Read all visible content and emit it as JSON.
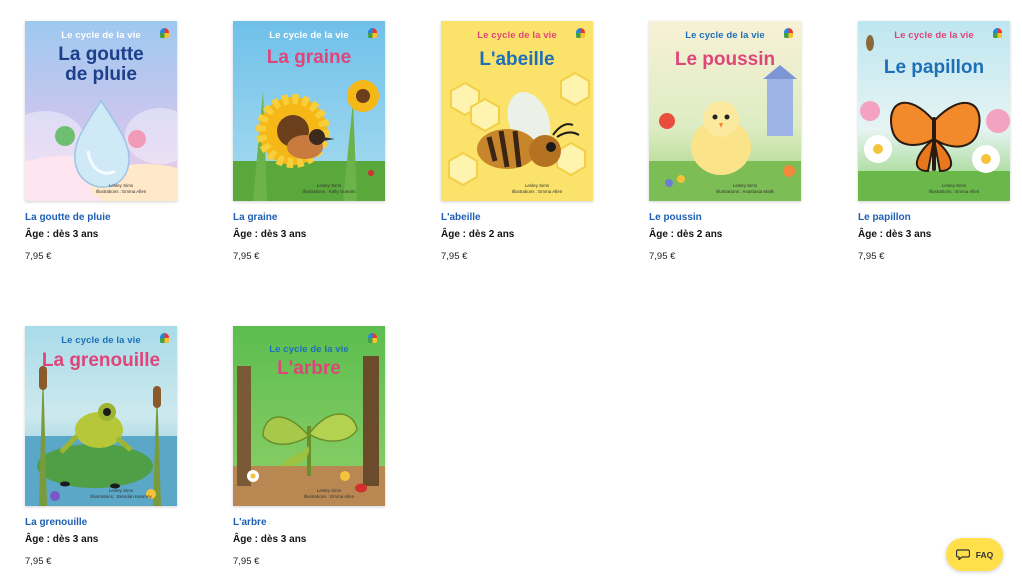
{
  "series_label": "Le cycle de la vie",
  "books": [
    {
      "title": "La goutte de pluie",
      "cover_title_lines": [
        "La goutte",
        "de pluie"
      ],
      "age": "Âge : dès 3 ans",
      "price": "7,95 €",
      "credit_author": "Lesley Sims",
      "credit_illus": "Illustrations : Emma Allen",
      "theme": "rain",
      "bg": "#b9d6f2",
      "title_color": "#1d3f8a",
      "series_color": "#ffffff"
    },
    {
      "title": "La graine",
      "cover_title_lines": [
        "La graine"
      ],
      "age": "Âge : dès 3 ans",
      "price": "7,95 €",
      "credit_author": "Lesley Sims",
      "credit_illus": "Illustrations : Kelly Gunnim",
      "theme": "seed",
      "bg": "#7cc6e8",
      "title_color": "#e0457a",
      "series_color": "#ffffff"
    },
    {
      "title": "L'abeille",
      "cover_title_lines": [
        "L'abeille"
      ],
      "age": "Âge : dès 2 ans",
      "price": "7,95 €",
      "credit_author": "Lesley Sims",
      "credit_illus": "Illustrations : Emma Allen",
      "theme": "bee",
      "bg": "#fbe36b",
      "title_color": "#1d6fb8",
      "series_color": "#e0457a"
    },
    {
      "title": "Le poussin",
      "cover_title_lines": [
        "Le poussin"
      ],
      "age": "Âge : dès 2 ans",
      "price": "7,95 €",
      "credit_author": "Lesley Sims",
      "credit_illus": "Illustrations : Anastasia Malik",
      "theme": "chick",
      "bg": "#f6efc9",
      "title_color": "#e0457a",
      "series_color": "#1d6fb8"
    },
    {
      "title": "Le papillon",
      "cover_title_lines": [
        "Le papillon"
      ],
      "age": "Âge : dès 3 ans",
      "price": "7,95 €",
      "credit_author": "Lesley Sims",
      "credit_illus": "Illustrations : Emma Allen",
      "theme": "butterfly",
      "bg": "#bfe6ef",
      "title_color": "#1d6fb8",
      "series_color": "#e0457a"
    },
    {
      "title": "La grenouille",
      "cover_title_lines": [
        "La grenouille"
      ],
      "age": "Âge : dès 3 ans",
      "price": "7,95 €",
      "credit_author": "Lesley Sims",
      "credit_illus": "Illustrations : Brendan Kearney",
      "theme": "frog",
      "bg": "#a8d8e6",
      "title_color": "#e0457a",
      "series_color": "#1d6fb8"
    },
    {
      "title": "L'arbre",
      "cover_title_lines": [
        "L'arbre"
      ],
      "age": "Âge : dès 3 ans",
      "price": "7,95 €",
      "credit_author": "Lesley Sims",
      "credit_illus": "Illustrations : Emma Allen",
      "theme": "tree",
      "bg": "#5cbd4e",
      "title_color": "#e0457a",
      "series_color": "#1d6fb8"
    }
  ],
  "faq": {
    "label": "FAQ",
    "icon": "chat-bubble-icon",
    "bg": "#ffe04a"
  }
}
